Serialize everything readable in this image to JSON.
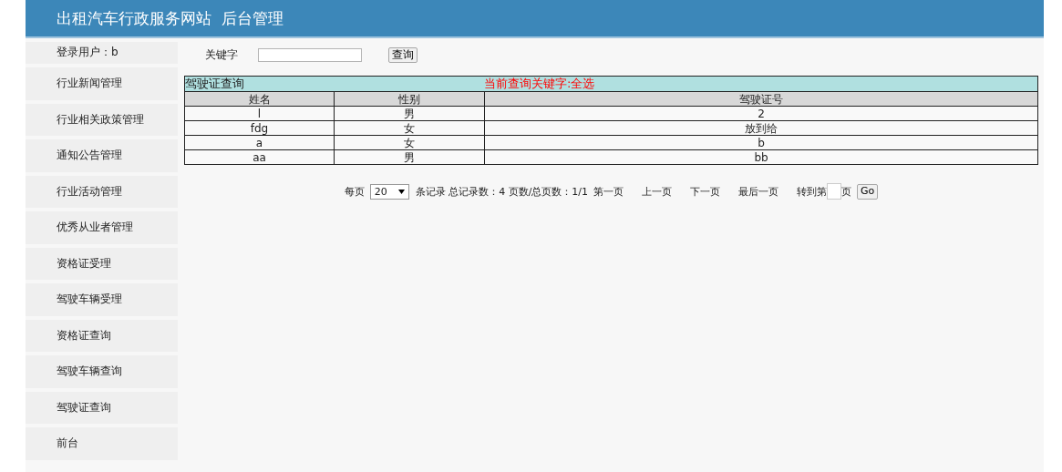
{
  "header": {
    "title": "出租汽车行政服务网站  后台管理"
  },
  "sidebar": {
    "user_label": "登录用户：b",
    "items": [
      {
        "label": "行业新闻管理"
      },
      {
        "label": "行业相关政策管理"
      },
      {
        "label": "通知公告管理"
      },
      {
        "label": "行业活动管理"
      },
      {
        "label": "优秀从业者管理"
      },
      {
        "label": "资格证受理"
      },
      {
        "label": "驾驶车辆受理"
      },
      {
        "label": "资格证查询"
      },
      {
        "label": "驾驶车辆查询"
      },
      {
        "label": "驾驶证查询"
      },
      {
        "label": "前台"
      }
    ]
  },
  "search": {
    "label": "关键字",
    "button": "查询"
  },
  "table": {
    "title": "驾驶证查询",
    "keyword_note": "当前查询关键字:全选",
    "columns": [
      "姓名",
      "性别",
      "驾驶证号"
    ],
    "rows": [
      [
        "l",
        "男",
        "2"
      ],
      [
        "fdg",
        "女",
        "放到给"
      ],
      [
        "a",
        "女",
        "b"
      ],
      [
        "aa",
        "男",
        "bb"
      ]
    ]
  },
  "pagination": {
    "per_page_label": "每页",
    "per_page": "20",
    "summary": "条记录 总记录数：4 页数/总页数：1/1",
    "first": "第一页",
    "prev": "上一页",
    "next": "下一页",
    "last": "最后一页",
    "goto_label": "转到第",
    "goto_suffix": "页",
    "go": "Go"
  }
}
